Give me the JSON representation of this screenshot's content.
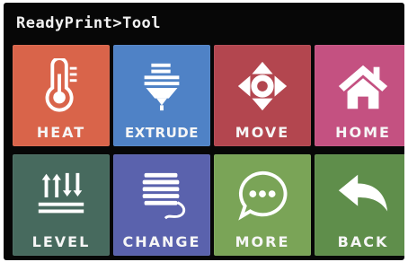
{
  "header": {
    "title": "ReadyPrint>Tool"
  },
  "colors": {
    "screen_bg": "#070707",
    "heat": "#d9644a",
    "extrude": "#4f82c6",
    "move": "#b3464f",
    "home": "#c45181",
    "level": "#476a5e",
    "change": "#5a62ad",
    "more": "#7aa457",
    "back": "#5f8e4b",
    "icon_white": "#ffffff"
  },
  "tiles": [
    {
      "label": "HEAT",
      "icon": "thermometer-icon"
    },
    {
      "label": "EXTRUDE",
      "icon": "extruder-icon"
    },
    {
      "label": "MOVE",
      "icon": "move-arrows-icon"
    },
    {
      "label": "HOME",
      "icon": "home-icon"
    },
    {
      "label": "LEVEL",
      "icon": "level-arrows-icon"
    },
    {
      "label": "CHANGE",
      "icon": "filament-spool-icon"
    },
    {
      "label": "MORE",
      "icon": "chat-bubble-icon"
    },
    {
      "label": "BACK",
      "icon": "back-arrow-icon"
    }
  ]
}
